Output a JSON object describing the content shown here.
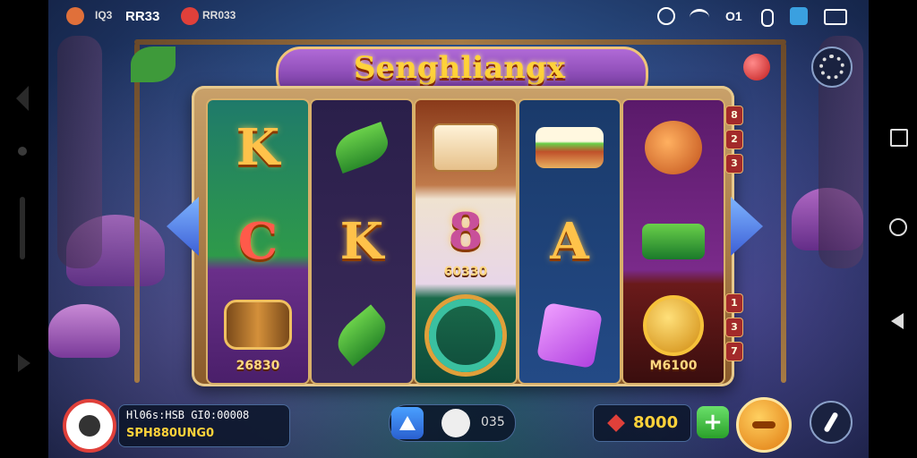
{
  "status_bar": {
    "left_text_1": "RR33",
    "left_text_2": "RR33",
    "left_text_3": "RR33"
  },
  "game": {
    "title": "Senghliangx",
    "reel_captions": {
      "reel1_row3": "26830",
      "reel3_row2": "60330",
      "reel5_row3": "M6100"
    },
    "letters": {
      "reel1_row1": "K",
      "reel1_row2": "C",
      "reel2_row2": "K",
      "reel3_row2": "8",
      "reel4_row2": "A"
    },
    "paylines_right_top": [
      "2",
      "3"
    ],
    "paylines_right_bottom": [
      "1",
      "3",
      "7"
    ],
    "paylines_badge": "8"
  },
  "bottom": {
    "player_line_1": "Hl06s:HSB GI0:00008",
    "player_line_2": "SPH880UNG0",
    "bet_label": "035",
    "coins_value": "8000"
  },
  "icons": {
    "home": "home-icon",
    "settings": "gear-icon",
    "add": "plus-icon",
    "spin": "spin-icon",
    "sound": "sound-icon"
  },
  "colors": {
    "title": "#ffd23a",
    "frame": "#c9a16a",
    "accent_green": "#3cc84a",
    "accent_red": "#e0403a"
  }
}
